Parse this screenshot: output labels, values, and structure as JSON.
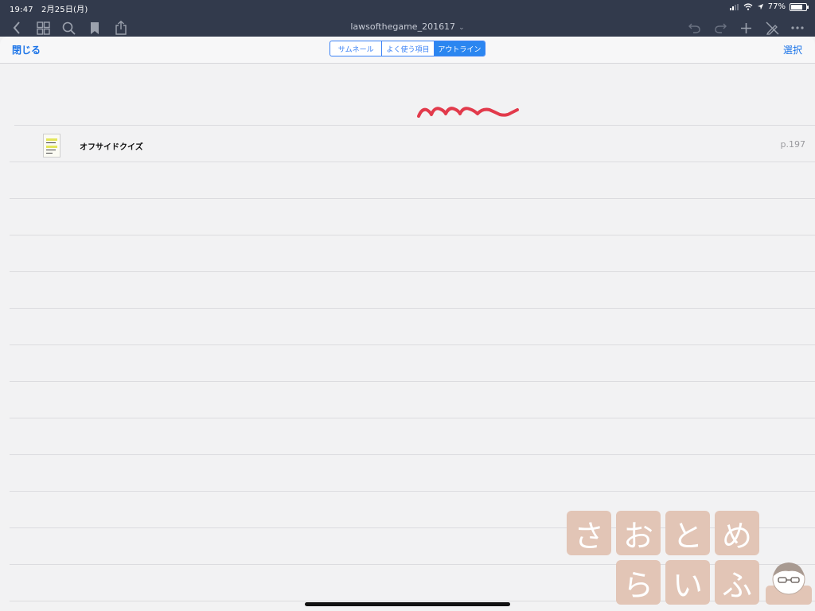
{
  "status_bar": {
    "time": "19:47",
    "date": "2月25日(月)",
    "battery": "77%",
    "battery_level": 0.77
  },
  "toolbar": {
    "document_title": "lawsofthegame_201617",
    "icons": [
      "back-icon",
      "grid-icon",
      "search-icon",
      "bookmark-icon",
      "share-icon",
      "undo-icon",
      "redo-icon",
      "add-icon",
      "pen-off-icon",
      "more-icon"
    ]
  },
  "navbar": {
    "close_label": "閉じる",
    "select_label": "選択",
    "segments": [
      {
        "label": "サムネール",
        "active": false
      },
      {
        "label": "よく使う項目",
        "active": false
      },
      {
        "label": "アウトライン",
        "active": true
      }
    ]
  },
  "outline": {
    "items": [
      {
        "title": "オフサイドクイズ",
        "page": "p.197"
      }
    ]
  },
  "watermark": {
    "text": "さおとめらいふ"
  },
  "colors": {
    "topbar": "#323a4c",
    "accent": "#2b86f0",
    "squiggle": "#e23a4b"
  }
}
